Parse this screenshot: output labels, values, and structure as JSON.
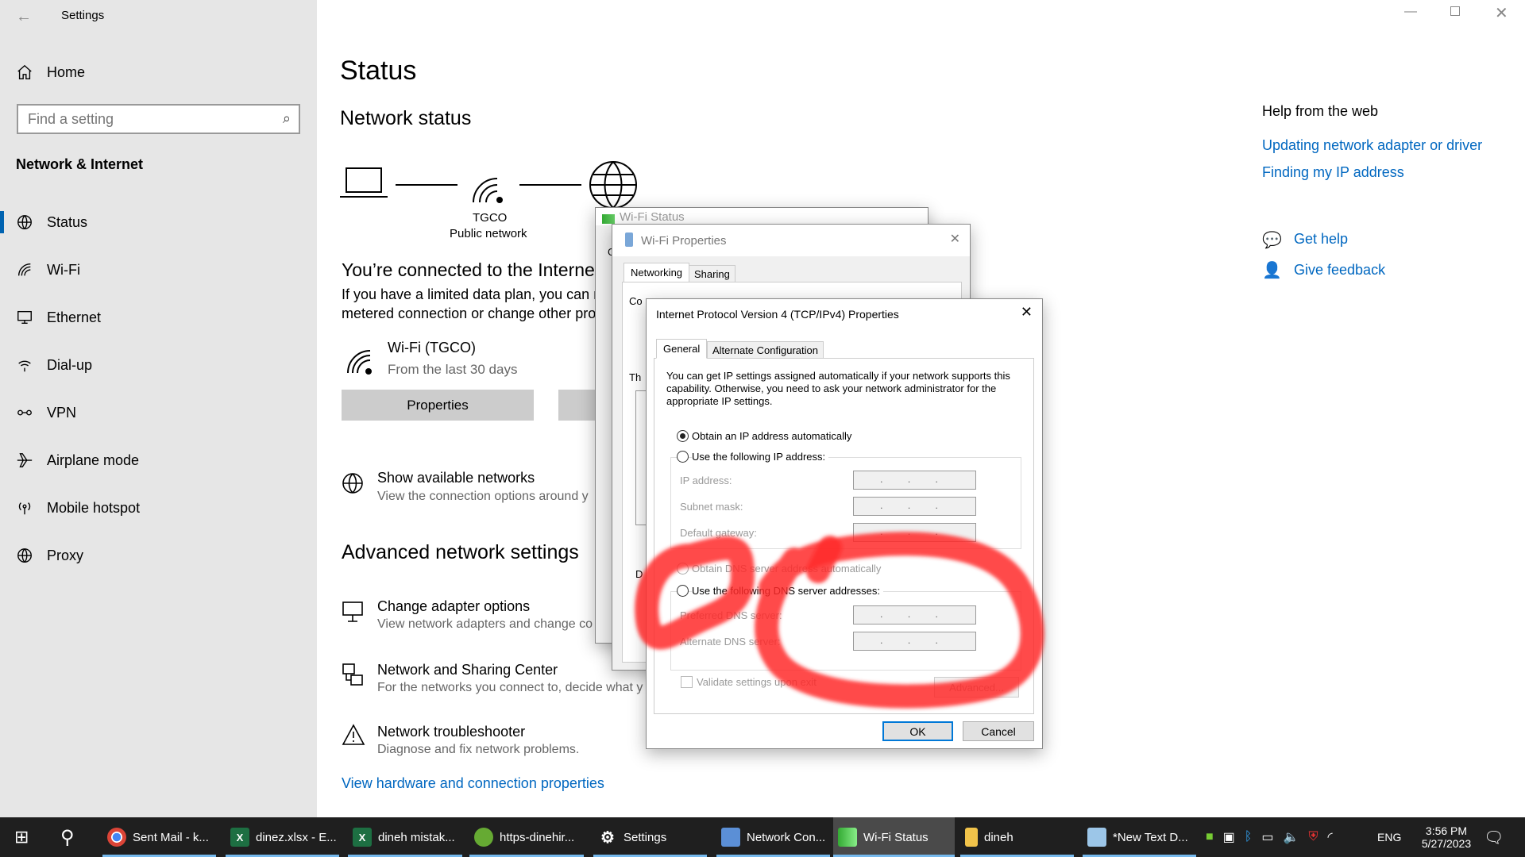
{
  "window": {
    "title": "Settings"
  },
  "sidebar": {
    "home": "Home",
    "search_placeholder": "Find a setting",
    "section": "Network & Internet",
    "items": [
      {
        "label": "Status"
      },
      {
        "label": "Wi-Fi"
      },
      {
        "label": "Ethernet"
      },
      {
        "label": "Dial-up"
      },
      {
        "label": "VPN"
      },
      {
        "label": "Airplane mode"
      },
      {
        "label": "Mobile hotspot"
      },
      {
        "label": "Proxy"
      }
    ]
  },
  "main": {
    "title": "Status",
    "network_status": "Network status",
    "network_name": "TGCO",
    "network_type": "Public network",
    "connected": "You’re connected to the Internet",
    "desc1": "If you have a limited data plan, you can m",
    "desc2": "metered connection or change other prop",
    "wifi_name": "Wi-Fi (TGCO)",
    "wifi_usage": "From the last 30 days",
    "properties_button": "Properties",
    "show_networks": "Show available networks",
    "show_networks_sub": "View the connection options around y",
    "advanced_title": "Advanced network settings",
    "adv": [
      {
        "title": "Change adapter options",
        "sub": "View network adapters and change co"
      },
      {
        "title": "Network and Sharing Center",
        "sub": "For the networks you connect to, decide what y"
      },
      {
        "title": "Network troubleshooter",
        "sub": "Diagnose and fix network problems."
      }
    ],
    "hardware_link": "View hardware and connection properties"
  },
  "help": {
    "title": "Help from the web",
    "links": [
      "Updating network adapter or driver",
      "Finding my IP address"
    ],
    "get_help": "Get help",
    "feedback": "Give feedback"
  },
  "wifi_status": {
    "title": "Wi-Fi Status",
    "tab_initial": "G"
  },
  "wifi_props": {
    "title": "Wi-Fi Properties",
    "tabs": [
      "Networking",
      "Sharing"
    ],
    "connect_label": "Co",
    "this_label": "Th",
    "d_label": "D"
  },
  "ipv4": {
    "title": "Internet Protocol Version 4 (TCP/IPv4) Properties",
    "tabs": [
      "General",
      "Alternate Configuration"
    ],
    "intro": "You can get IP settings assigned automatically if your network supports this capability. Otherwise, you need to ask your network administrator for the appropriate IP settings.",
    "obtain_ip": "Obtain an IP address automatically",
    "use_ip": "Use the following IP address:",
    "ip_address": "IP address:",
    "subnet": "Subnet mask:",
    "gateway": "Default gateway:",
    "obtain_dns": "Obtain DNS server address automatically",
    "use_dns": "Use the following DNS server addresses:",
    "preferred_dns": "Preferred DNS server:",
    "alternate_dns": "Alternate DNS server:",
    "empty_ip": ". . .",
    "validate": "Validate settings upon exit",
    "advanced": "Advanced...",
    "ok": "OK",
    "cancel": "Cancel",
    "obtain_ip_selected": true
  },
  "annotation_color": "#ff2020",
  "taskbar": {
    "items": [
      {
        "label": "Sent Mail - k..."
      },
      {
        "label": "dinez.xlsx - E..."
      },
      {
        "label": "dineh mistak..."
      },
      {
        "label": "https-dinehir..."
      },
      {
        "label": "Settings"
      },
      {
        "label": "Network Con..."
      },
      {
        "label": "Wi-Fi Status"
      },
      {
        "label": "dineh"
      },
      {
        "label": "*New Text D..."
      }
    ],
    "language": "ENG",
    "time": "3:56 PM",
    "date": "5/27/2023"
  }
}
